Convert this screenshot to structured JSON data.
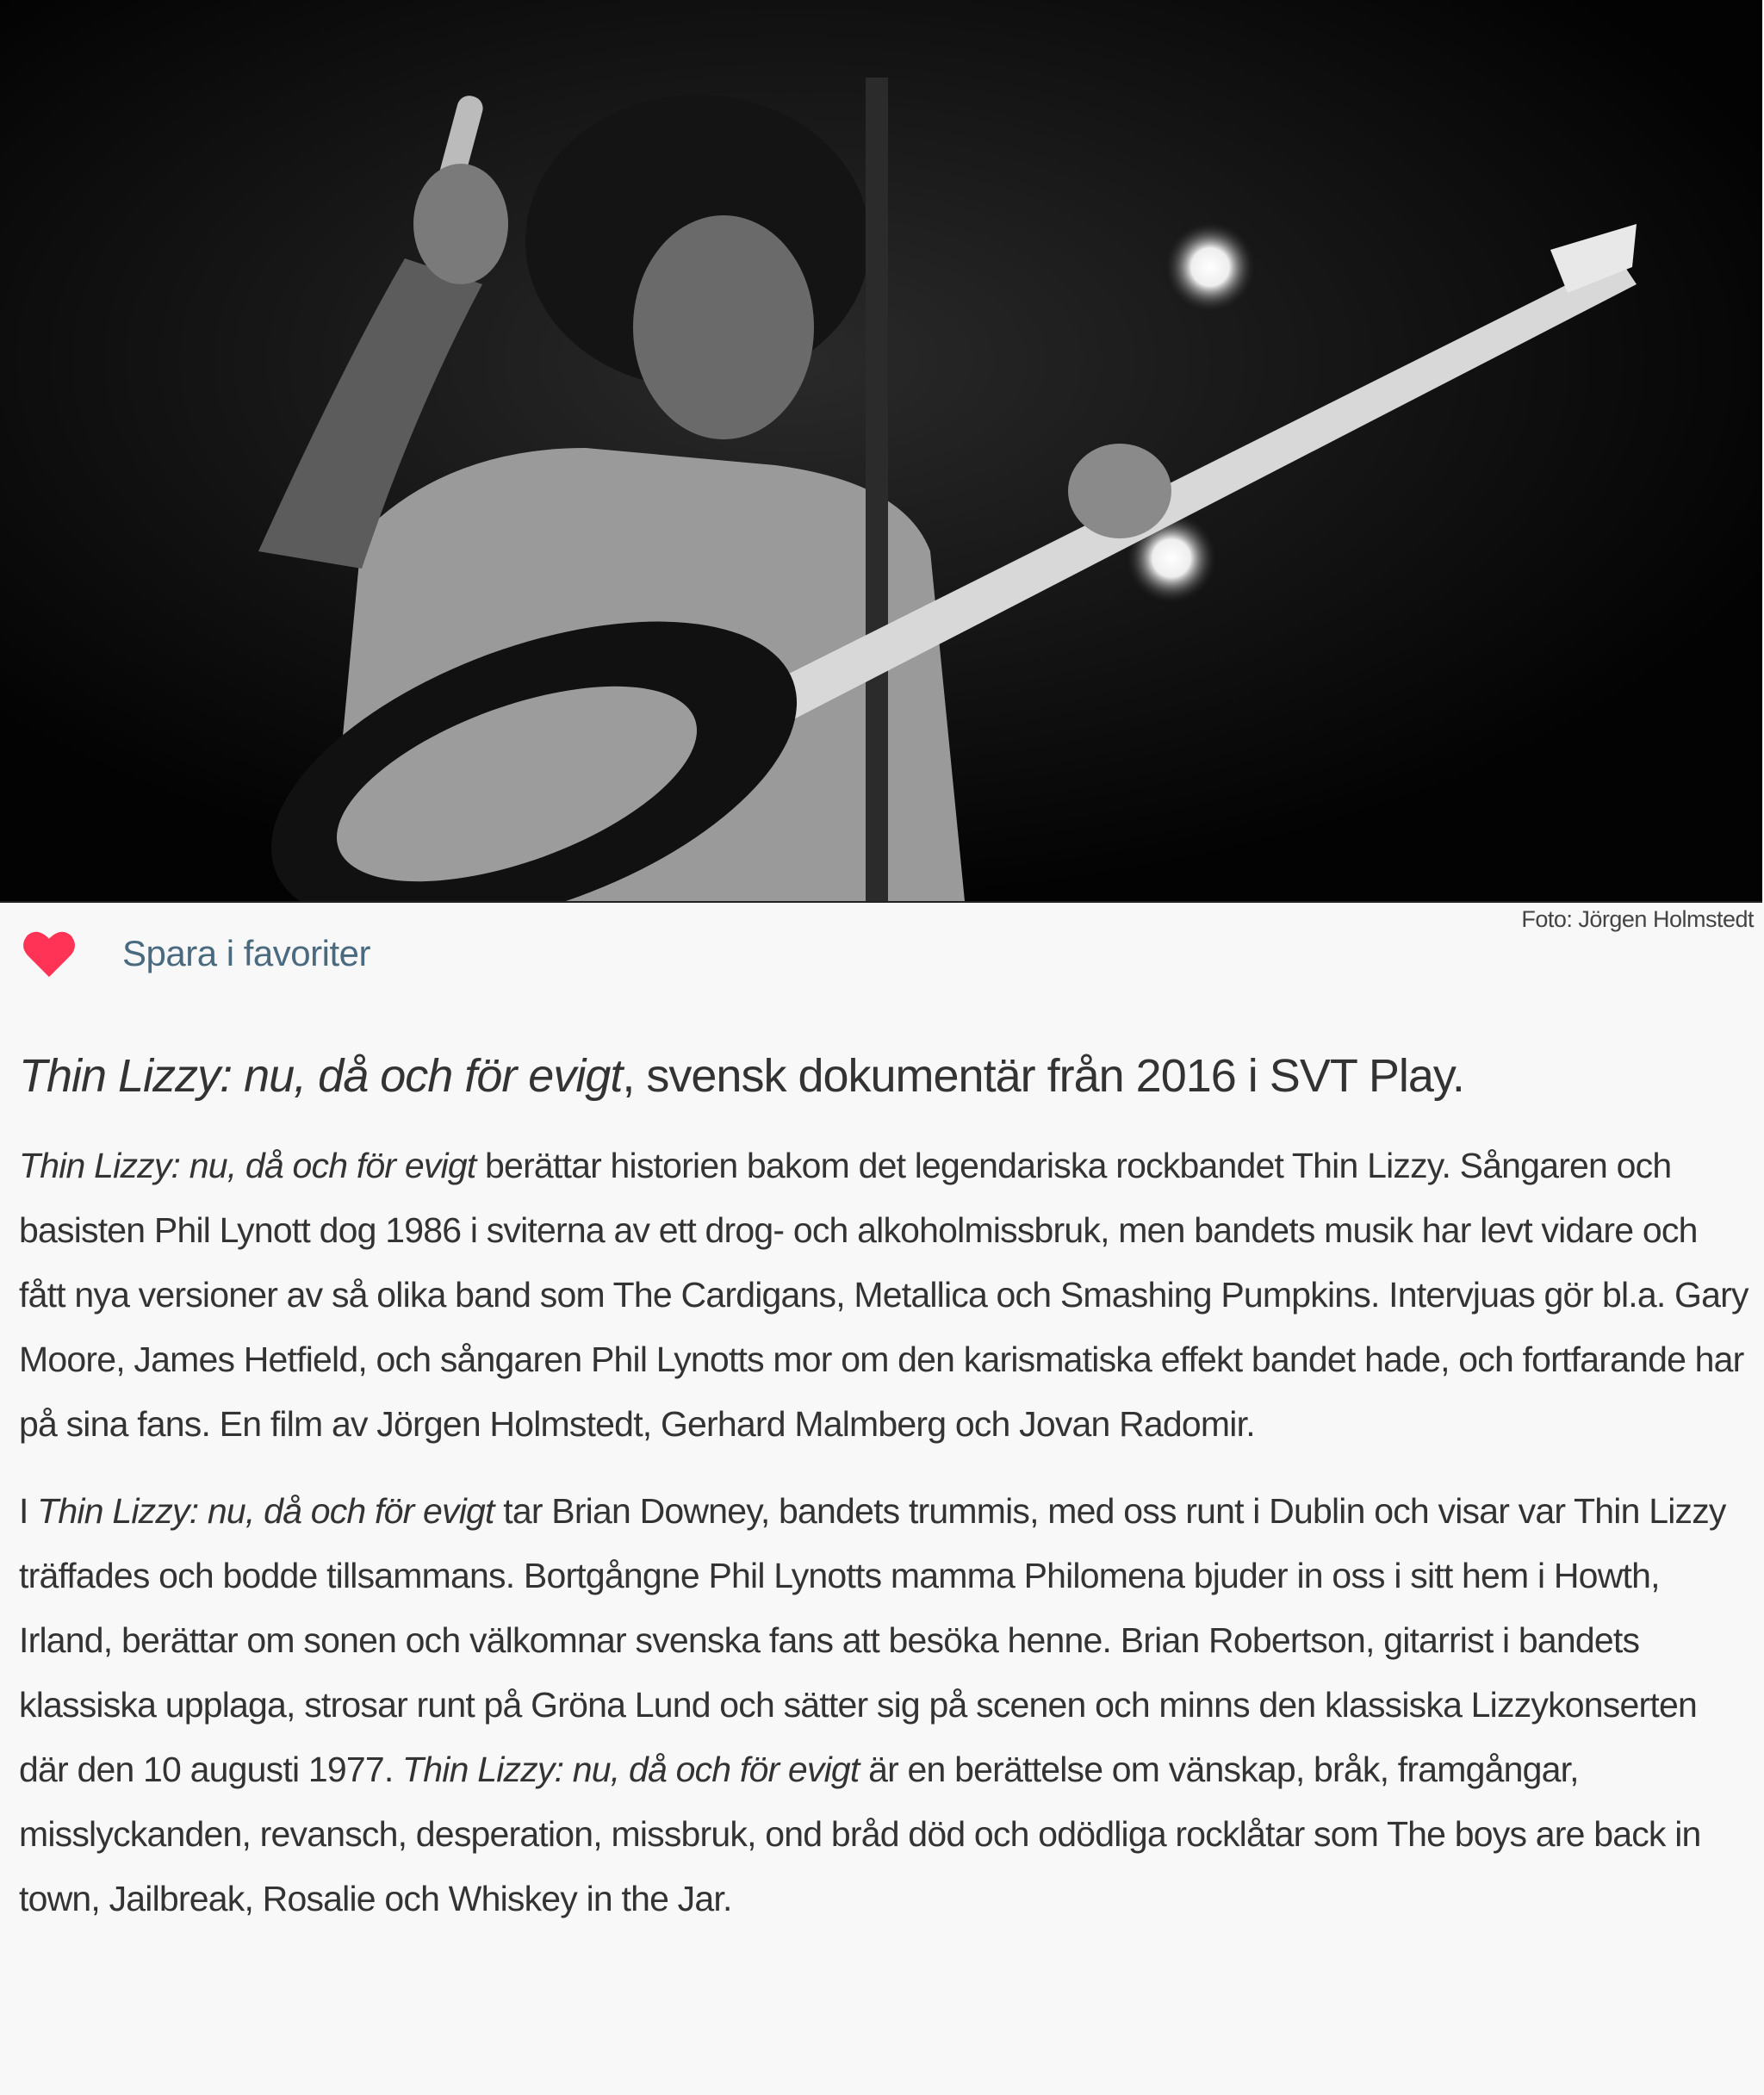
{
  "photo": {
    "credit": "Foto: Jörgen Holmstedt"
  },
  "favorite": {
    "label": "Spara i favoriter",
    "icon": "heart-icon",
    "color": "#ff3355"
  },
  "article": {
    "headline": {
      "title": "Thin Lizzy: nu, då och för evigt",
      "rest": ", svensk dokumentär från 2016 i SVT Play."
    },
    "paragraph1": {
      "title": "Thin Lizzy: nu, då och för evigt",
      "text": " berättar historien bakom det legendariska rockbandet Thin Lizzy. Sångaren och basisten Phil Lynott dog 1986 i sviterna av ett drog- och alkoholmissbruk, men bandets musik har levt vidare och fått nya versioner av så olika band som The Cardigans, Metallica och Smashing Pumpkins. Intervjuas gör bl.a. Gary Moore, James Hetfield, och sångaren Phil Lynotts mor om den karismatiska effekt bandet hade, och fortfarande har på sina fans. En film av Jörgen Holmstedt, Gerhard Malmberg och Jovan Radomir."
    },
    "paragraph2": {
      "prefix": "I ",
      "title": "Thin Lizzy: nu, då och för evigt",
      "text": " tar Brian Downey, bandets trummis, med oss runt i Dublin och visar var Thin Lizzy träffades och bodde tillsammans. Bortgångne Phil Lynotts mamma Philomena bjuder in oss i sitt hem i Howth, Irland, berättar om sonen och välkomnar svenska fans att besöka henne. Brian Robertson, gitarrist i bandets klassiska upplaga, strosar runt på Gröna Lund och sätter sig på scenen och minns den klassiska Lizzykonserten där den 10 augusti 1977. ",
      "title2": "Thin Lizzy: nu, då och för evigt",
      "text2": " är en berättelse om vänskap, bråk, framgångar, misslyckanden, revansch, desperation, missbruk, ond bråd död och odödliga rocklåtar som The boys are back in town, Jailbreak, Rosalie och Whiskey in the Jar."
    }
  }
}
